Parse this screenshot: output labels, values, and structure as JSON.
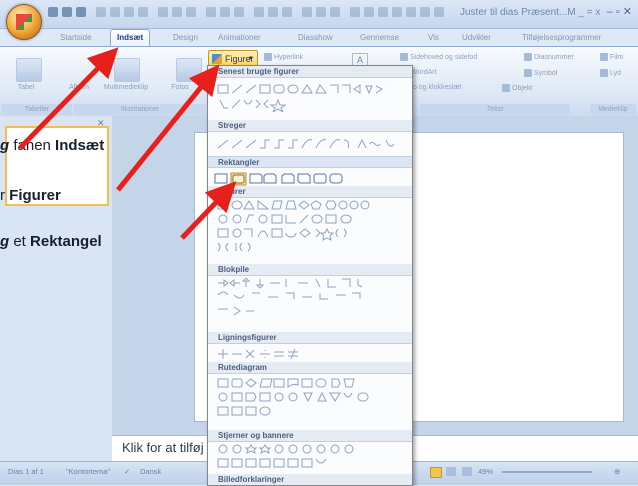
{
  "titlebar": {
    "title": "Juster til dias  Præsent...M _ = x",
    "window_controls": "–  ▫  ✕"
  },
  "tabs": [
    "Startside",
    "Indsæt",
    "Design",
    "Animationer",
    "Diasshow",
    "Gennemse",
    "Vis",
    "Udvikler",
    "Tilføjelsesprogrammer"
  ],
  "active_tab": "Indsæt",
  "ribbon": {
    "tabel": "Tabel",
    "album": "Album",
    "multimedie": "Multimedieklip",
    "foto": "Fotos",
    "figurer": "Figurer",
    "hyperlink": "Hyperlink",
    "sidehoved": "Sidehoved og sidefod",
    "diasnummer": "Diasnummer",
    "wordart": "WordArt",
    "symbol": "Symbol",
    "dato": "to og klokkeslæt",
    "objekt": "Objekt",
    "film": "Film",
    "lyd": "Lyd",
    "groups": {
      "tabeller": "Tabeller",
      "illustrationer": "Illustrationer",
      "tekst": "Tekst",
      "medieklip": "Medieklip"
    }
  },
  "dropdown": {
    "sections": [
      "Senest brugte figurer",
      "Streger",
      "Rektangler",
      "Figurer",
      "Blokpile",
      "Ligningsfigurer",
      "Rutediagram",
      "Stjerner og bannere",
      "Billedforklaringer"
    ]
  },
  "notes": {
    "placeholder": "Klik for at tilføj"
  },
  "status": {
    "slide": "Dias 1 af 1",
    "theme": "\"Kontortema\"",
    "lang": "Dansk",
    "zoom": "49%"
  },
  "instructions": {
    "line1_italic": "g",
    "line1_text": " fanen ",
    "line1_bold": "Indsæt",
    "line2_text": "r ",
    "line2_bold": "Figurer",
    "line3_italic": "g",
    "line3_text": " et ",
    "line3_bold": "Rektangel"
  },
  "colors": {
    "arrow": "#e8201c",
    "ribbon": "#dce7f5",
    "highlight": "#ffd35f"
  }
}
